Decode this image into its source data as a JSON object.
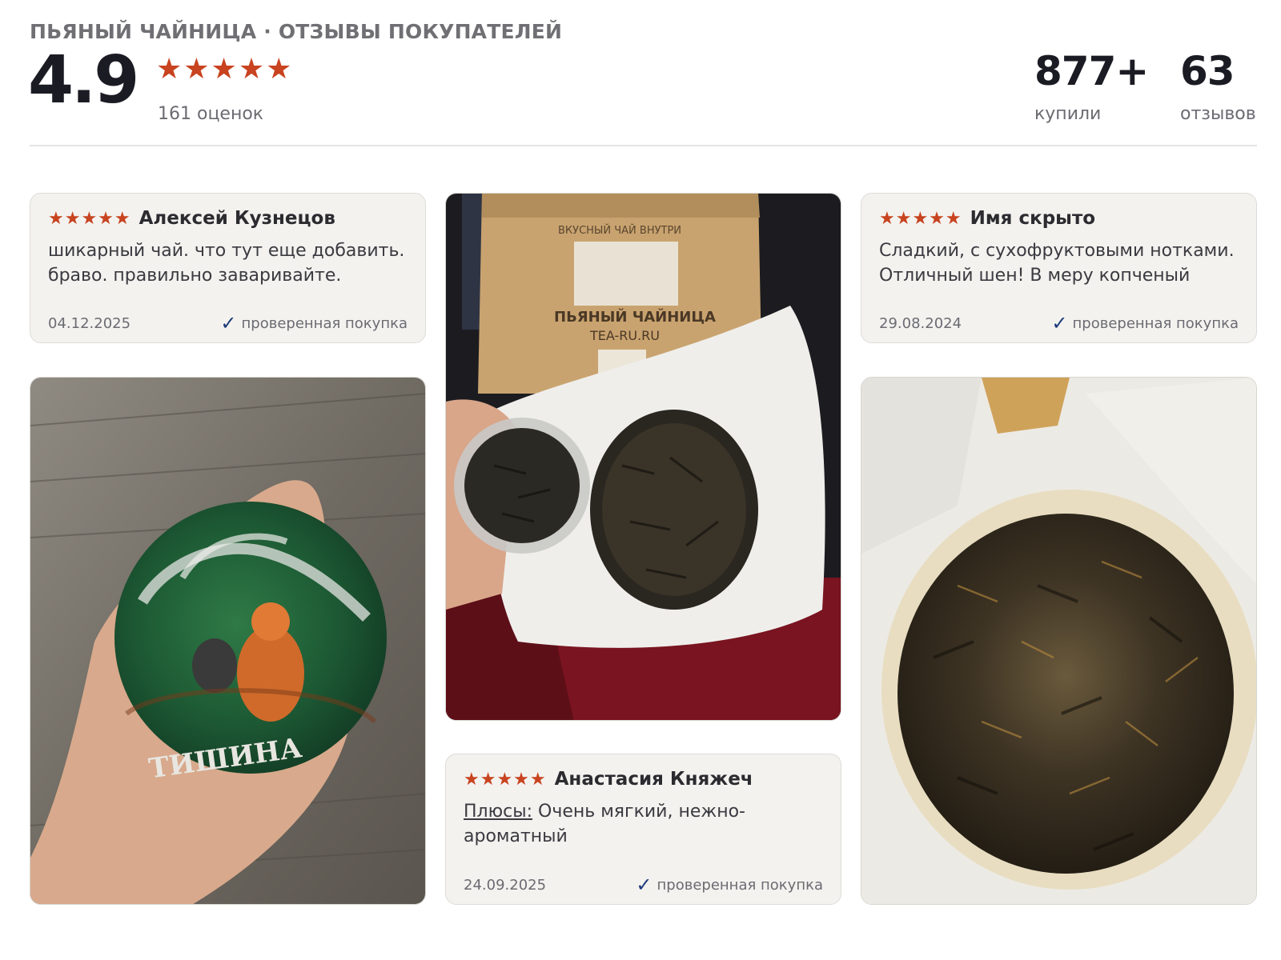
{
  "header": {
    "title": "ПЬЯНЫЙ ЧАЙНИЦА · ОТЗЫВЫ ПОКУПАТЕЛЕЙ",
    "rating": "4.9",
    "stars": "★★★★★",
    "rating_count": "161 оценок",
    "bought_value": "877+",
    "bought_label": "купили",
    "reviews_value": "63",
    "reviews_label": "отзывов"
  },
  "colors": {
    "star": "#c8431f",
    "card_bg": "#f3f2ef",
    "check": "#1e3c78"
  },
  "reviews": [
    {
      "stars": "★★★★★",
      "author": "Алексей Кузнецов",
      "text": "шикарный чай. что тут еще добавить. браво. правильно заваривайте.",
      "date": "04.12.2025",
      "verified_icon": "check-icon",
      "verified": "проверенная покупка"
    },
    {
      "stars": "★★★★★",
      "author": "Имя скрыто",
      "text": "Сладкий, с сухофруктовыми нотками. Отличный шен! В меру копченый",
      "date": "29.08.2024",
      "verified_icon": "check-icon",
      "verified": "проверенная покупка"
    },
    {
      "stars": "★★★★★",
      "author": "Анастасия Княжеч",
      "pros_label": "Плюсы:",
      "text": "Очень мягкий, нежно-ароматный",
      "date": "24.09.2025",
      "verified_icon": "check-icon",
      "verified": "проверенная покупка"
    }
  ],
  "photos": {
    "photo1": {
      "cake_label": "ТИШИНА"
    },
    "photo2": {
      "bag_top": "ВКУСНЫЙ ЧАЙ ВНУТРИ",
      "bag_brand": "ПЬЯНЫЙ ЧАЙНИЦА",
      "bag_site": "TEA-RU.RU"
    }
  }
}
